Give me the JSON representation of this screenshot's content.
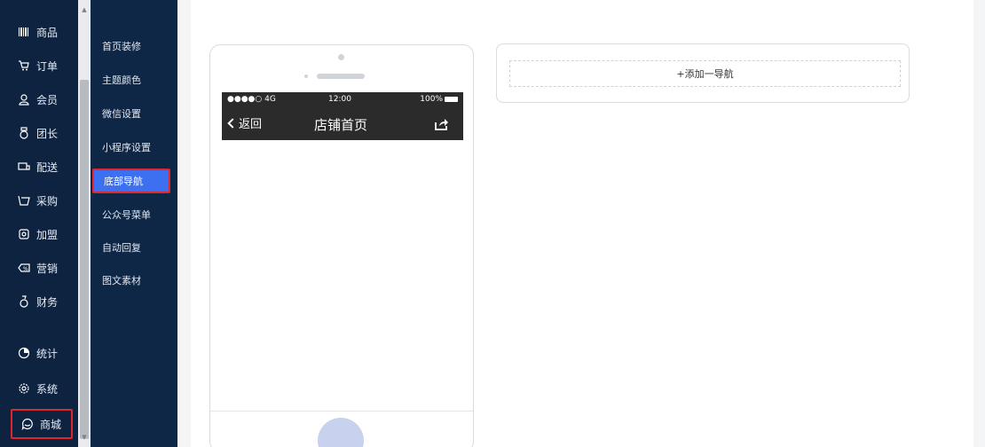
{
  "primary_menu": [
    {
      "label": "商品",
      "icon": "barcode-icon"
    },
    {
      "label": "订单",
      "icon": "cart-icon"
    },
    {
      "label": "会员",
      "icon": "user-icon"
    },
    {
      "label": "团长",
      "icon": "medal-icon"
    },
    {
      "label": "配送",
      "icon": "truck-icon"
    },
    {
      "label": "采购",
      "icon": "basket-icon"
    },
    {
      "label": "加盟",
      "icon": "shield-icon"
    },
    {
      "label": "营销",
      "icon": "coupon-icon"
    },
    {
      "label": "财务",
      "icon": "money-bag-icon"
    },
    {
      "label": "统计",
      "icon": "pie-chart-icon"
    },
    {
      "label": "系统",
      "icon": "gear-icon"
    },
    {
      "label": "商城",
      "icon": "chat-icon"
    }
  ],
  "secondary_menu": [
    {
      "label": "首页装修"
    },
    {
      "label": "主题颜色"
    },
    {
      "label": "微信设置"
    },
    {
      "label": "小程序设置"
    },
    {
      "label": "底部导航"
    },
    {
      "label": "公众号菜单"
    },
    {
      "label": "自动回复"
    },
    {
      "label": "图文素材"
    }
  ],
  "phone": {
    "signal": "●●●●○ 4G",
    "time": "12:00",
    "battery": "100%",
    "back_label": "返回",
    "title": "店铺首页"
  },
  "nav_panel": {
    "add_label": "+添加一导航"
  },
  "colors": {
    "primary_bg": "#0e2340",
    "secondary_bg": "#0f2747",
    "active": "#3d6ff1",
    "highlight": "#e0262d"
  }
}
